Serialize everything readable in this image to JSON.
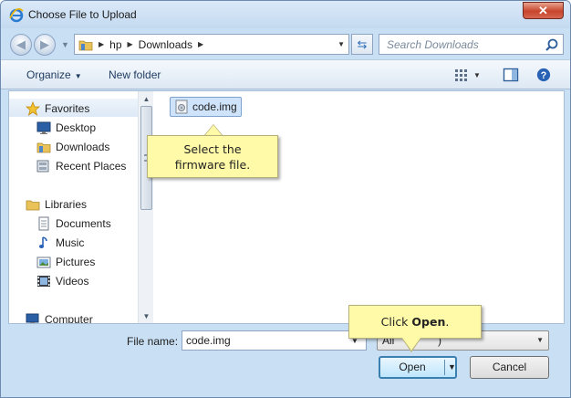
{
  "window": {
    "title": "Choose File to Upload",
    "close_label": "✕"
  },
  "address": {
    "segments": [
      "hp",
      "Downloads"
    ]
  },
  "search": {
    "placeholder": "Search Downloads"
  },
  "toolbar": {
    "organize_label": "Organize",
    "new_folder_label": "New folder"
  },
  "nav": {
    "favorites": {
      "label": "Favorites",
      "items": [
        "Desktop",
        "Downloads",
        "Recent Places"
      ]
    },
    "libraries": {
      "label": "Libraries",
      "items": [
        "Documents",
        "Music",
        "Pictures",
        "Videos"
      ]
    },
    "computer": {
      "label": "Computer"
    }
  },
  "files": [
    {
      "name": "code.img",
      "selected": true
    }
  ],
  "callouts": {
    "select_line1": "Select the",
    "select_line2": "firmware file.",
    "open_prefix": "Click ",
    "open_bold": "Open",
    "open_suffix": "."
  },
  "footer": {
    "filename_label": "File name:",
    "filename_value": "code.img",
    "filter_value": "All",
    "filter_suffix": ")",
    "open_label": "Open",
    "cancel_label": "Cancel"
  },
  "colors": {
    "callout": "#fffaa8",
    "selection": "#cfe3fa",
    "titlebar": "#c4daf1"
  },
  "icons": [
    "internet-explorer-icon",
    "back-arrow-icon",
    "forward-arrow-icon",
    "folder-icon",
    "refresh-icon",
    "search-icon",
    "views-icon",
    "preview-pane-icon",
    "help-icon",
    "star-icon",
    "desktop-icon",
    "downloads-icon",
    "recent-places-icon",
    "libraries-icon",
    "documents-icon",
    "music-icon",
    "pictures-icon",
    "videos-icon",
    "computer-icon",
    "disk-image-icon"
  ]
}
